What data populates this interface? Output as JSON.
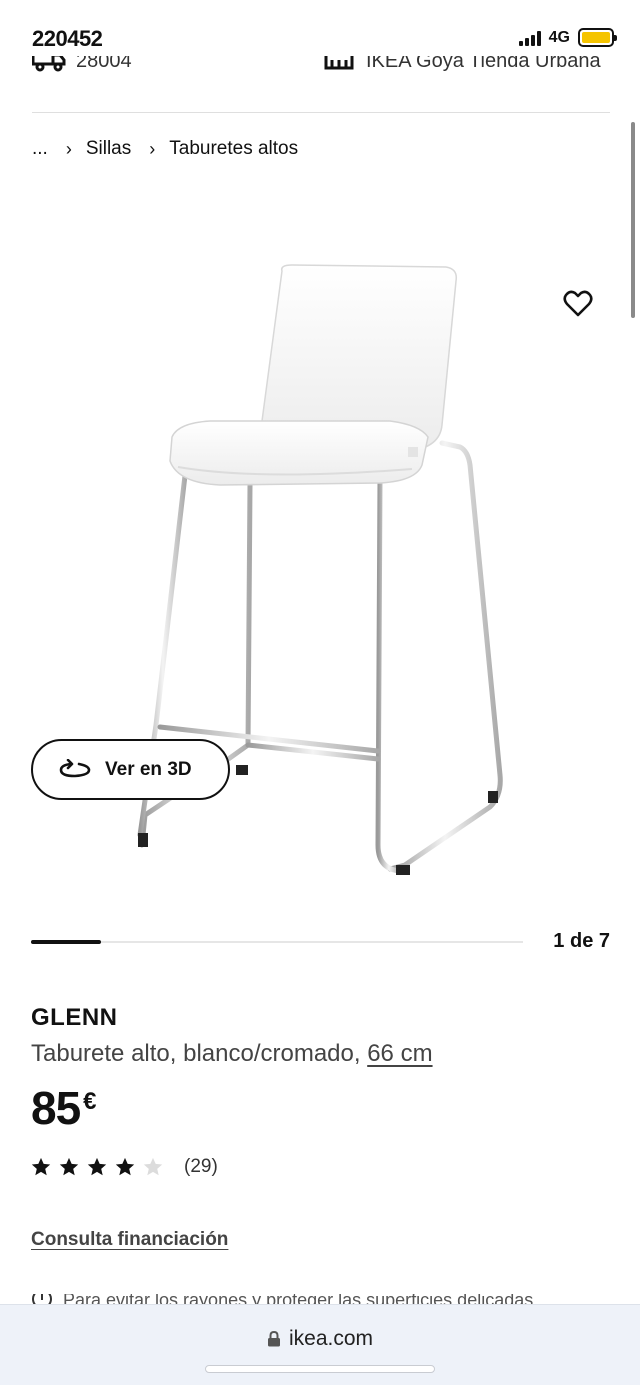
{
  "status_bar": {
    "time": "220452",
    "network": "4G",
    "battery_color": "#f5c400"
  },
  "store_bar": {
    "left_text": "28004",
    "right_text": "IKEA Goya Tienda Urbana"
  },
  "breadcrumb": {
    "ellipsis": "...",
    "items": [
      "Sillas",
      "Taburetes altos"
    ]
  },
  "gallery": {
    "view_3d_label": "Ver en 3D",
    "position_label": "1 de 7",
    "progress_fraction": 0.142857
  },
  "product": {
    "name": "GLENN",
    "description": "Taburete alto, blanco/cromado, ",
    "size_link": "66 cm",
    "price_amount": "85",
    "price_currency": "€",
    "rating_value": 4,
    "rating_max": 5,
    "rating_count": "(29)",
    "financing_link": "Consulta financiación",
    "notice_text": "Para evitar los rayones y proteger las superficies delicadas"
  },
  "browser": {
    "url": "ikea.com"
  },
  "icons": {
    "favorite": "heart-icon",
    "view_3d": "rotate-3d-icon",
    "lock": "lock-icon",
    "delivery": "truck-icon",
    "store": "store-icon",
    "info": "info-icon"
  }
}
